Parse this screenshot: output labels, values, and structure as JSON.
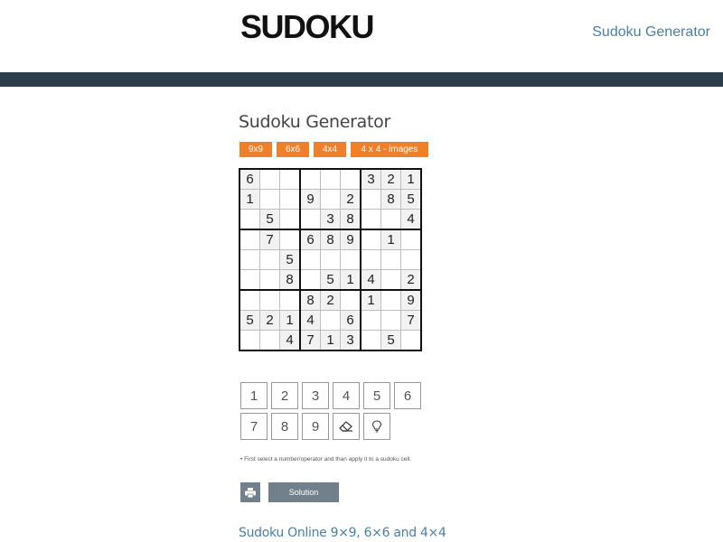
{
  "header": {
    "logo": "SUDOKU",
    "nav_link": "Sudoku Generator"
  },
  "main": {
    "title": "Sudoku Generator",
    "modes": [
      "9x9",
      "6x6",
      "4x4",
      "4 x 4 - images"
    ],
    "grid": [
      [
        "6",
        "",
        "",
        "",
        "",
        "",
        "3",
        "2",
        "1"
      ],
      [
        "1",
        "",
        "",
        "9",
        "",
        "2",
        "",
        "8",
        "5"
      ],
      [
        "",
        "5",
        "",
        "",
        "3",
        "8",
        "",
        "",
        "4"
      ],
      [
        "",
        "7",
        "",
        "6",
        "8",
        "9",
        "",
        "1",
        ""
      ],
      [
        "",
        "",
        "5",
        "",
        "",
        "",
        "",
        "",
        ""
      ],
      [
        "",
        "",
        "8",
        "",
        "5",
        "1",
        "4",
        "",
        "2"
      ],
      [
        "",
        "",
        "",
        "8",
        "2",
        "",
        "1",
        "",
        "9"
      ],
      [
        "5",
        "2",
        "1",
        "4",
        "",
        "6",
        "",
        "",
        "7"
      ],
      [
        "",
        "",
        "4",
        "7",
        "1",
        "3",
        "",
        "5",
        ""
      ]
    ],
    "number_pad": [
      "1",
      "2",
      "3",
      "4",
      "5",
      "6",
      "7",
      "8",
      "9"
    ],
    "hint_text": "• First select a number/operator and than apply it to a sudoku cell.",
    "solution_label": "Solution"
  },
  "footer": {
    "link_text": "Sudoku Online 9×9, 6×6 and 4×4"
  },
  "colors": {
    "mode_button": "#f07f2a",
    "nav_bar": "#2c3e4c",
    "action_button": "#71808a",
    "link": "#4a7fa7"
  }
}
